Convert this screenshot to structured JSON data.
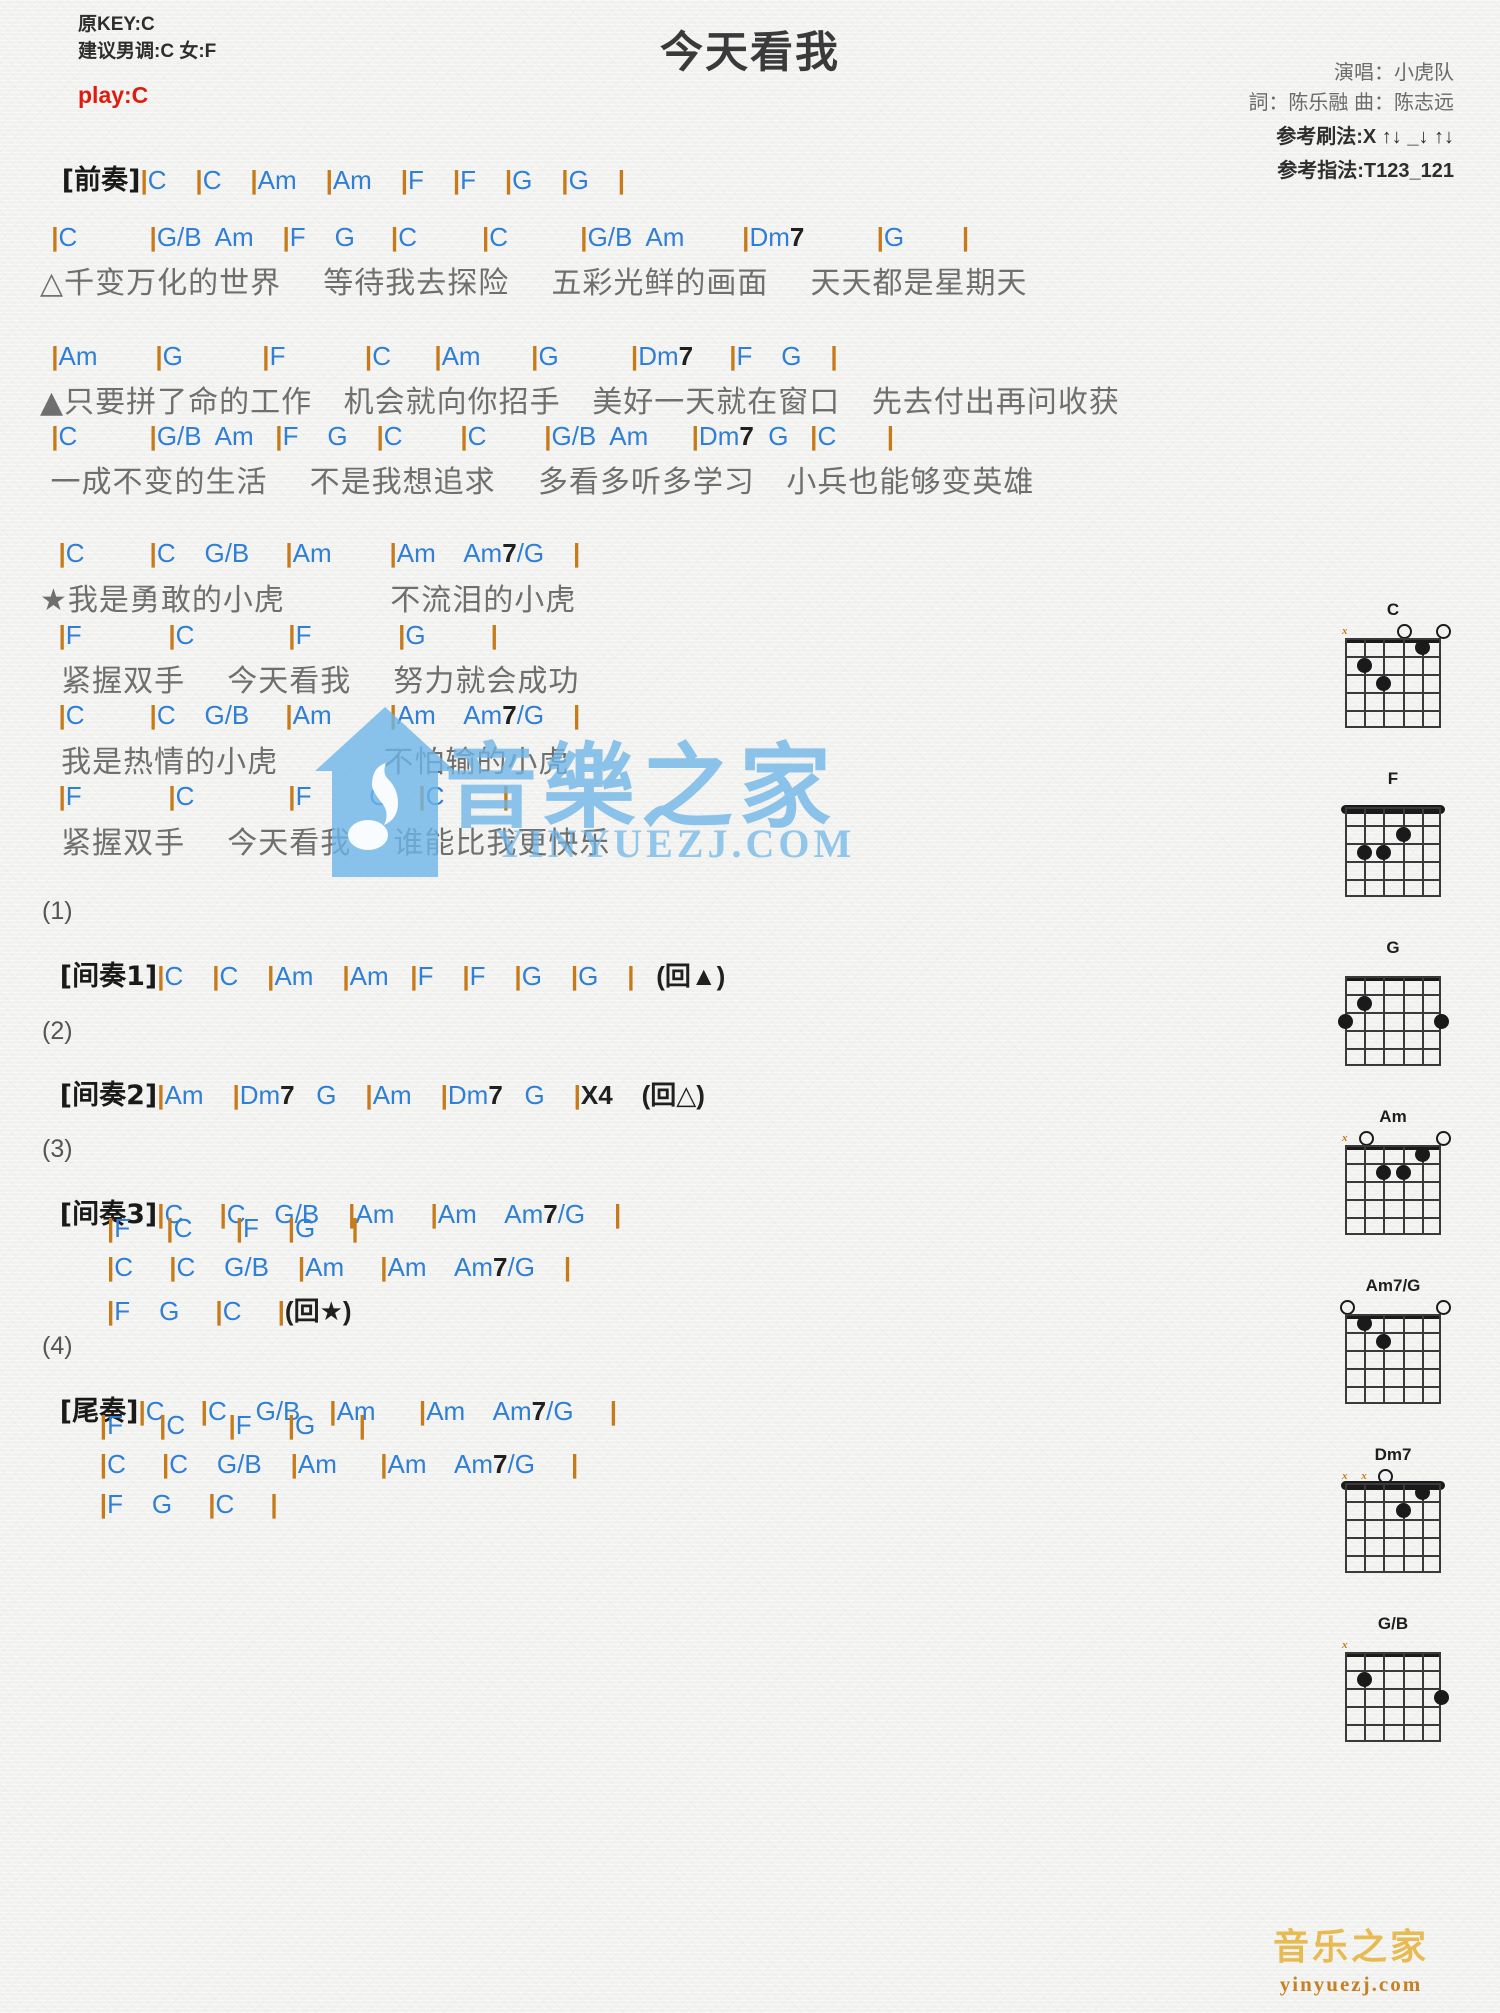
{
  "header": {
    "title": "今天看我",
    "key_line": "原KEY:C",
    "suggest_line": "建议男调:C 女:F",
    "play_line": "play:C",
    "singer": "演唱：小虎队",
    "writers": "詞：陈乐融  曲：陈志远",
    "strum": "参考刷法:X ↑↓ _↓ ↑↓",
    "fingering": "参考指法:T123_121"
  },
  "sections": {
    "intro_label": "[前奏]",
    "intro_chords": "|C    |C    |Am    |Am    |F    |F    |G    |G    |",
    "verse1": {
      "chords_a": " |C          |G/B  Am    |F    G     |C         |C          |G/B  Am        |Dm7          |G        |",
      "lyrics_a": "△千变万化的世界    等待我去探险    五彩光鲜的画面    天天都是星期天"
    },
    "verse2": {
      "chords_a": " |Am        |G           |F           |C      |Am       |G          |Dm7     |F    G    |",
      "lyrics_a": "▲只要拼了命的工作   机会就向你招手   美好一天就在窗口   先去付出再问收获",
      "chords_b": " |C          |G/B  Am   |F    G    |C        |C        |G/B  Am      |Dm7  G   |C       |",
      "lyrics_b": " 一成不变的生活    不是我想追求    多看多听多学习   小兵也能够变英雄"
    },
    "chorus": {
      "chords_a": "  |C         |C    G/B     |Am        |Am    Am7/G    |",
      "lyrics_a": "★我是勇敢的小虎          不流泪的小虎",
      "chords_b": "  |F            |C             |F            |G         |",
      "lyrics_b": "  紧握双手    今天看我    努力就会成功",
      "chords_c": "  |C         |C    G/B     |Am        |Am    Am7/G    |",
      "lyrics_c": "  我是热情的小虎          不怕输的小虎",
      "chords_d": "  |F            |C             |F        G    |C        |",
      "lyrics_d": "  紧握双手    今天看我    谁能比我更快乐"
    },
    "interlude1": {
      "num": "(1)",
      "label": "[间奏1]",
      "chords": "|C    |C    |Am    |Am   |F    |F    |G    |G    |   (回▲)"
    },
    "interlude2": {
      "num": "(2)",
      "label": "[间奏2]",
      "chords": "|Am    |Dm7   G    |Am    |Dm7   G    |X4    (回△)"
    },
    "interlude3": {
      "num": "(3)",
      "label": "[间奏3]",
      "lines": [
        "|C     |C    G/B    |Am     |Am    Am7/G    |",
        "         |F     |C      |F    |G     |",
        "         |C     |C    G/B    |Am     |Am    Am7/G    |",
        "         |F    G     |C     |(回★)"
      ]
    },
    "outro": {
      "num": "(4)",
      "label": "[尾奏]",
      "lines": [
        "|C     |C    G/B    |Am      |Am    Am7/G     |",
        "        |F     |C      |F     |G      |",
        "        |C     |C    G/B    |Am      |Am    Am7/G     |",
        "        |F    G     |C     |"
      ]
    }
  },
  "chord_diagrams": [
    {
      "name": "C",
      "dots": [
        [
          2,
          5
        ],
        [
          3,
          4
        ],
        [
          1,
          2
        ]
      ],
      "open": [
        3,
        1
      ],
      "muted": [
        6
      ],
      "barre": false
    },
    {
      "name": "F",
      "dots": [
        [
          2,
          3
        ],
        [
          3,
          5
        ],
        [
          3,
          4
        ]
      ],
      "open": [],
      "muted": [],
      "barre": true
    },
    {
      "name": "G",
      "dots": [
        [
          2,
          5
        ],
        [
          3,
          6
        ],
        [
          3,
          1
        ]
      ],
      "open": [],
      "muted": [],
      "barre": false
    },
    {
      "name": "Am",
      "dots": [
        [
          2,
          4
        ],
        [
          2,
          3
        ],
        [
          1,
          2
        ]
      ],
      "open": [
        5,
        1
      ],
      "muted": [
        6
      ],
      "barre": false
    },
    {
      "name": "Am7/G",
      "dots": [
        [
          1,
          5
        ],
        [
          2,
          4
        ]
      ],
      "open": [
        6,
        1
      ],
      "muted": [],
      "barre": false
    },
    {
      "name": "Dm7",
      "dots": [
        [
          1,
          2
        ],
        [
          2,
          3
        ]
      ],
      "open": [
        4
      ],
      "muted": [
        6,
        5
      ],
      "barre": true
    },
    {
      "name": "G/B",
      "dots": [
        [
          2,
          5
        ],
        [
          3,
          1
        ]
      ],
      "open": [],
      "muted": [
        6
      ],
      "barre": false
    }
  ],
  "watermarks": {
    "center_text": "音樂之家",
    "center_url": "YINYUEZJ.COM",
    "corner_top": "音乐之家",
    "corner_bottom": "yinyuezj.com"
  },
  "colors": {
    "chord": "#2f7fd6",
    "bar": "#c77a1a",
    "lyric": "#6f6f6f",
    "accent_red": "#e01b0e",
    "watermark_blue": "#6db5e8"
  }
}
